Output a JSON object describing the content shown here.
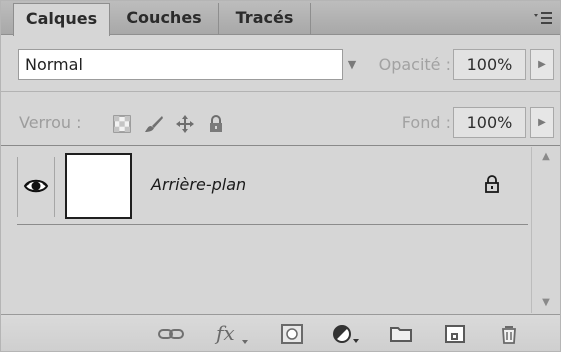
{
  "tabs": [
    {
      "label": "Calques",
      "active": true
    },
    {
      "label": "Couches",
      "active": false
    },
    {
      "label": "Tracés",
      "active": false
    }
  ],
  "panel_menu_icon": "panel-menu-icon",
  "blend": {
    "value": "Normal"
  },
  "opacity": {
    "label": "Opacité :",
    "value": "100%"
  },
  "lock": {
    "label": "Verrou :",
    "icons": [
      "lock-transparent-pixels-icon",
      "lock-image-pixels-icon",
      "lock-position-icon",
      "lock-all-icon"
    ]
  },
  "fill": {
    "label": "Fond :",
    "value": "100%"
  },
  "layers": [
    {
      "name": "Arrière-plan",
      "visible": true,
      "locked": true
    }
  ],
  "toolbar": {
    "fx_label": "fx",
    "icons": [
      "link-layers-icon",
      "layer-style-icon",
      "add-mask-icon",
      "adjustment-layer-icon",
      "new-group-icon",
      "new-layer-icon",
      "delete-layer-icon"
    ]
  },
  "colors": {
    "panel_bg": "#d6d6d6",
    "tab_bar": "#a8a8a8",
    "field_bg": "#e2e2e2"
  }
}
